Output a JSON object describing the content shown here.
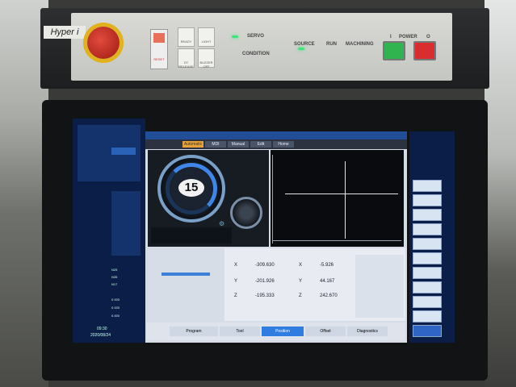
{
  "panel": {
    "brand": "Hyper i",
    "reset_label": "RESET",
    "servo": "SERVO",
    "condition": "CONDITION",
    "source": "SOURCE",
    "run": "RUN",
    "machining": "MACHINING",
    "power": "POWER",
    "power_on": "I",
    "power_off": "O",
    "buttons": [
      "READY",
      "LIGHT",
      "BUZZER OFF",
      "DT RELEASE",
      "ALARM RESET"
    ]
  },
  "screen": {
    "speed_value": "15",
    "tabs": [
      "Automatic",
      "MDI",
      "Manual",
      "Edit",
      "Home"
    ],
    "coordinates": {
      "x_machine": "-309.630",
      "y_machine": "-201.926",
      "z_machine": "-195.333",
      "x_work": "-5.926",
      "y_work": "44.167",
      "z_work": "242.670"
    },
    "bottom_tabs": [
      "Program",
      "Tool",
      "Position",
      "Offset",
      "Diagnostics"
    ],
    "left_values": [
      "N25",
      "N35",
      "N17",
      "0.000",
      "0.000",
      "0.000"
    ],
    "time": "09:30",
    "date": "2020/08/24"
  }
}
